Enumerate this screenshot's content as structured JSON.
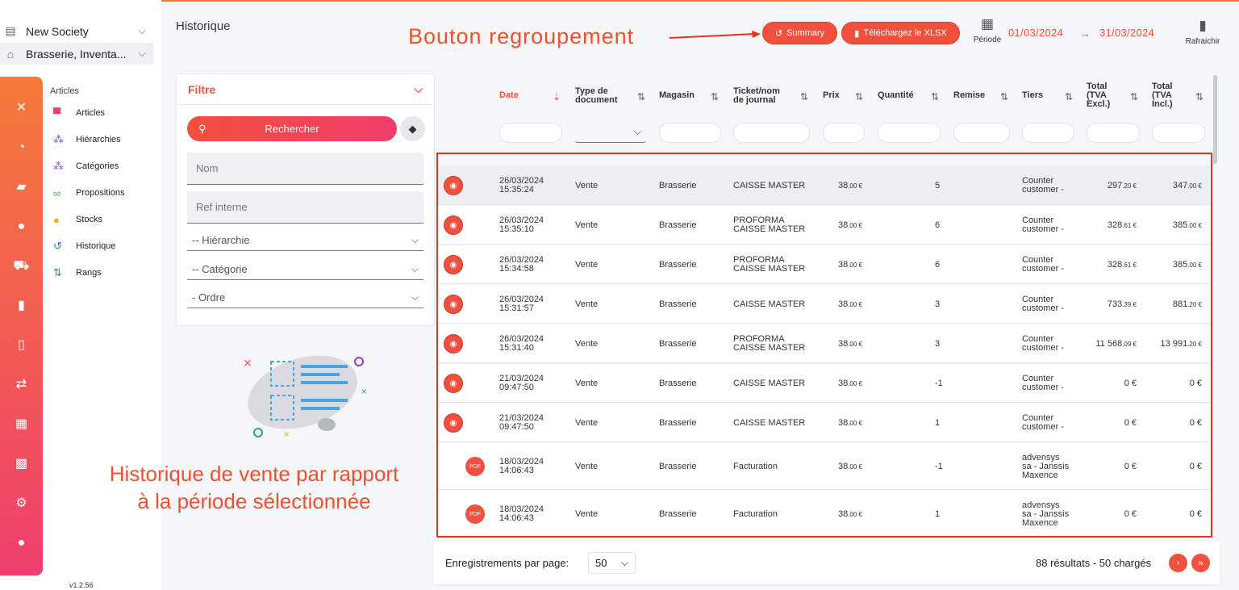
{
  "workspace": {
    "company": "New Society",
    "location": "Brasserie, Inventa..."
  },
  "submenu": {
    "title": "Articles",
    "items": [
      {
        "label": "Articles",
        "icon": "shirt-icon"
      },
      {
        "label": "Hiérarchies",
        "icon": "hierarchy-icon"
      },
      {
        "label": "Catégories",
        "icon": "category-icon"
      },
      {
        "label": "Propositions",
        "icon": "link-icon"
      },
      {
        "label": "Stocks",
        "icon": "coins-icon"
      },
      {
        "label": "Historique",
        "icon": "history-icon"
      },
      {
        "label": "Rangs",
        "icon": "sort-icon"
      }
    ]
  },
  "version": "v1.2.56",
  "page": {
    "title": "Historique"
  },
  "annotations": {
    "top": "Bouton regroupement",
    "left_line1": "Historique de vente par rapport",
    "left_line2": "à la période sélectionnée"
  },
  "toolbar": {
    "summary_label": "Summary",
    "xlsx_label": "Téléchargez le XLSX",
    "periode_label": "Période",
    "date_start": "01/03/2024",
    "date_arrow": "→",
    "date_end": "31/03/2024",
    "refresh_label": "Rafraichir"
  },
  "filter": {
    "title": "Filtre",
    "search_label": "Rechercher",
    "nom_placeholder": "Nom",
    "ref_placeholder": "Ref interne",
    "hierarchie": "-- Hiérarchie",
    "categorie": "-- Catégorie",
    "ordre": "- Ordre"
  },
  "table": {
    "headers": {
      "date": "Date",
      "type_l1": "Type de",
      "type_l2": "document",
      "magasin": "Magasin",
      "ticket_l1": "Ticket/nom",
      "ticket_l2": "de journal",
      "prix": "Prix",
      "quantite": "Quantité",
      "remise": "Remise",
      "tiers": "Tiers",
      "htva_l1": "Total",
      "htva_l2": "(TVA",
      "htva_l3": "Excl.)",
      "ttva_l1": "Total",
      "ttva_l2": "(TVA",
      "ttva_l3": "Incl.)"
    },
    "rows": [
      {
        "date": "26/03/2024",
        "time": "15:35:24",
        "type": "Vente",
        "magasin": "Brasserie",
        "ticket1": "CAISSE MASTER",
        "ticket2": "",
        "prix": "38",
        "prix_dec": ".00 €",
        "qte": "5",
        "tiers1": "Counter",
        "tiers2": "customer -",
        "tiers3": "",
        "htva": "297",
        "htva_dec": ".20 €",
        "ttva": "347",
        "ttva_dec": ".00 €",
        "action": "view"
      },
      {
        "date": "26/03/2024",
        "time": "15:35:10",
        "type": "Vente",
        "magasin": "Brasserie",
        "ticket1": "PROFORMA",
        "ticket2": "CAISSE MASTER",
        "prix": "38",
        "prix_dec": ".00 €",
        "qte": "6",
        "tiers1": "Counter",
        "tiers2": "customer -",
        "tiers3": "",
        "htva": "328",
        "htva_dec": ".61 €",
        "ttva": "385",
        "ttva_dec": ".00 €",
        "action": "view"
      },
      {
        "date": "26/03/2024",
        "time": "15:34:58",
        "type": "Vente",
        "magasin": "Brasserie",
        "ticket1": "PROFORMA",
        "ticket2": "CAISSE MASTER",
        "prix": "38",
        "prix_dec": ".00 €",
        "qte": "6",
        "tiers1": "Counter",
        "tiers2": "customer -",
        "tiers3": "",
        "htva": "328",
        "htva_dec": ".61 €",
        "ttva": "385",
        "ttva_dec": ".00 €",
        "action": "view"
      },
      {
        "date": "26/03/2024",
        "time": "15:31:57",
        "type": "Vente",
        "magasin": "Brasserie",
        "ticket1": "CAISSE MASTER",
        "ticket2": "",
        "prix": "38",
        "prix_dec": ".00 €",
        "qte": "3",
        "tiers1": "Counter",
        "tiers2": "customer -",
        "tiers3": "",
        "htva": "733",
        "htva_dec": ".39 €",
        "ttva": "881",
        "ttva_dec": ".20 €",
        "action": "view"
      },
      {
        "date": "26/03/2024",
        "time": "15:31:40",
        "type": "Vente",
        "magasin": "Brasserie",
        "ticket1": "PROFORMA",
        "ticket2": "CAISSE MASTER",
        "prix": "38",
        "prix_dec": ".00 €",
        "qte": "3",
        "tiers1": "Counter",
        "tiers2": "customer -",
        "tiers3": "",
        "htva": "11 568",
        "htva_dec": ".09 €",
        "ttva": "13 991",
        "ttva_dec": ".20 €",
        "action": "view"
      },
      {
        "date": "21/03/2024",
        "time": "09:47:50",
        "type": "Vente",
        "magasin": "Brasserie",
        "ticket1": "CAISSE MASTER",
        "ticket2": "",
        "prix": "38",
        "prix_dec": ".00 €",
        "qte": "-1",
        "tiers1": "Counter",
        "tiers2": "customer -",
        "tiers3": "",
        "htva": "0 €",
        "htva_dec": "",
        "ttva": "0 €",
        "ttva_dec": "",
        "action": "view"
      },
      {
        "date": "21/03/2024",
        "time": "09:47:50",
        "type": "Vente",
        "magasin": "Brasserie",
        "ticket1": "CAISSE MASTER",
        "ticket2": "",
        "prix": "38",
        "prix_dec": ".00 €",
        "qte": "1",
        "tiers1": "Counter",
        "tiers2": "customer -",
        "tiers3": "",
        "htva": "0 €",
        "htva_dec": "",
        "ttva": "0 €",
        "ttva_dec": "",
        "action": "view"
      },
      {
        "date": "18/03/2024",
        "time": "14:06:43",
        "type": "Vente",
        "magasin": "Brasserie",
        "ticket1": "Facturation",
        "ticket2": "",
        "prix": "38",
        "prix_dec": ".00 €",
        "qte": "-1",
        "tiers1": "advensys",
        "tiers2": "sa - Janssis",
        "tiers3": "Maxence",
        "htva": "0 €",
        "htva_dec": "",
        "ttva": "0 €",
        "ttva_dec": "",
        "action": "pdf"
      },
      {
        "date": "18/03/2024",
        "time": "14:06:43",
        "type": "Vente",
        "magasin": "Brasserie",
        "ticket1": "Facturation",
        "ticket2": "",
        "prix": "38",
        "prix_dec": ".00 €",
        "qte": "1",
        "tiers1": "advensys",
        "tiers2": "sa - Janssis",
        "tiers3": "Maxence",
        "htva": "0 €",
        "htva_dec": "",
        "ttva": "0 €",
        "ttva_dec": "",
        "action": "pdf"
      }
    ]
  },
  "footer": {
    "per_page_label": "Enregistrements par page:",
    "per_page_value": "50",
    "results": "88 résultats - 50 chargés"
  },
  "colors": {
    "accent": "#f1503c",
    "annotation": "#e8321f",
    "rail_top": "#f47a3a",
    "rail_bottom": "#ef3e6e"
  }
}
